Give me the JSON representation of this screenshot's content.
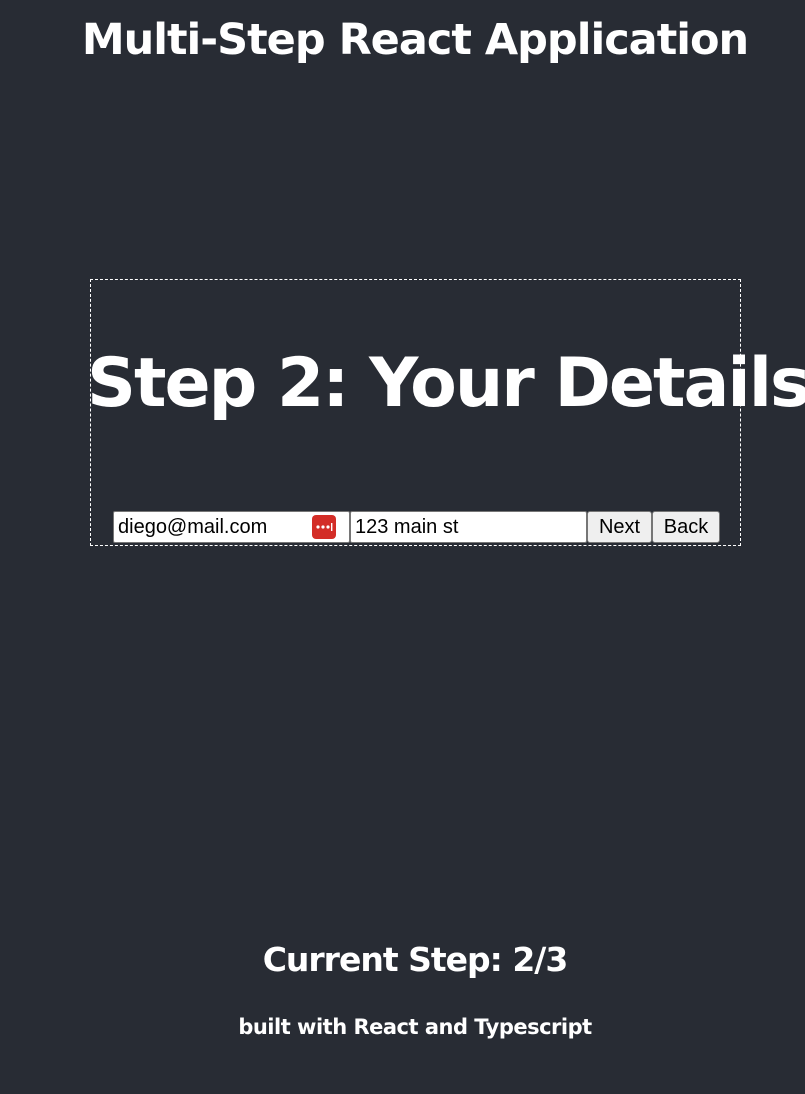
{
  "app": {
    "title": "Multi-Step React Application"
  },
  "step": {
    "heading": "Step 2: Your Details",
    "email_value": "diego@mail.com",
    "address_value": "123 main st",
    "next_label": "Next",
    "back_label": "Back",
    "password_manager_icon": "password-manager-icon"
  },
  "progress": {
    "label": "Current Step: 2/3",
    "current": 2,
    "total": 3
  },
  "footer": {
    "note": "built with React and Typescript"
  },
  "colors": {
    "background": "#282c34",
    "text": "#ffffff",
    "icon_accent": "#d32d27"
  }
}
